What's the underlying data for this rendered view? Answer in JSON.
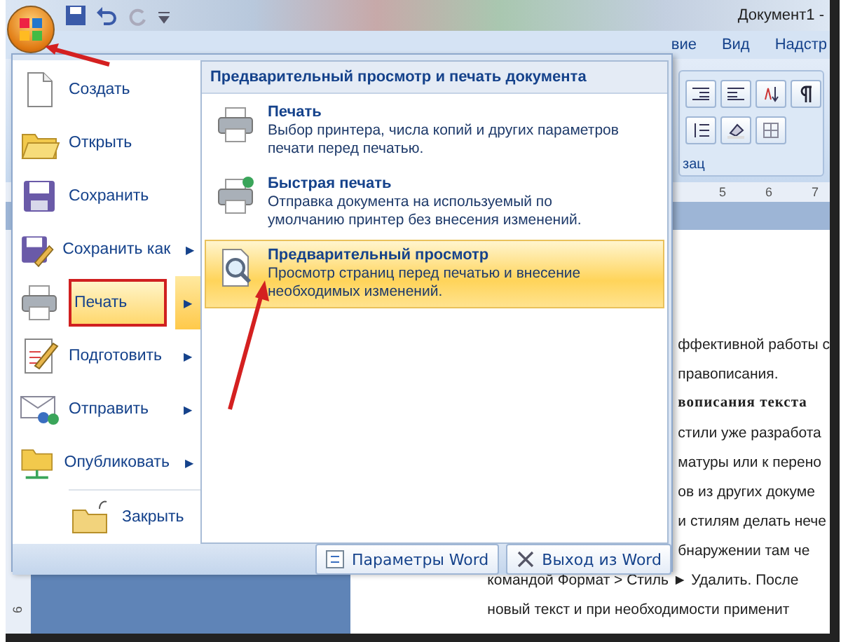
{
  "window": {
    "title": "Документ1 -"
  },
  "ribbon_tabs": [
    {
      "label": "вие"
    },
    {
      "label": "Вид"
    },
    {
      "label": "Надстр"
    }
  ],
  "ribbon": {
    "group_label": "зац",
    "ruler": [
      "5",
      "6",
      "7"
    ]
  },
  "office_menu": {
    "items": [
      {
        "label": "Создать",
        "kind": "new",
        "selected": false
      },
      {
        "label": "Открыть",
        "kind": "open",
        "selected": false
      },
      {
        "label": "Сохранить",
        "kind": "save",
        "selected": false
      },
      {
        "label": "Сохранить как",
        "kind": "saveas",
        "arrow": "▶",
        "selected": false
      },
      {
        "label": "Печать",
        "kind": "print",
        "arrow": "▶",
        "selected": true
      },
      {
        "label": "Подготовить",
        "kind": "prepare",
        "arrow": "▶",
        "selected": false
      },
      {
        "label": "Отправить",
        "kind": "send",
        "arrow": "▶",
        "selected": false
      },
      {
        "label": "Опубликовать",
        "kind": "publish",
        "arrow": "▶",
        "selected": false
      },
      {
        "label": "Закрыть",
        "kind": "close",
        "selected": false
      }
    ],
    "panel": {
      "title": "Предварительный просмотр и печать документа",
      "items": [
        {
          "title": "Печать",
          "description": "Выбор принтера, числа копий и других параметров печати перед печатью.",
          "kind": "print",
          "selected": false
        },
        {
          "title": "Быстрая печать",
          "description": "Отправка документа на используемый по умолчанию принтер без внесения изменений.",
          "kind": "quickprint",
          "selected": false
        },
        {
          "title": "Предварительный просмотр",
          "description": "Просмотр страниц перед печатью и внесение необходимых изменений.",
          "kind": "preview",
          "selected": true
        }
      ]
    },
    "buttons": [
      {
        "label": "Параметры Word",
        "kind": "options"
      },
      {
        "label": "Выход из Word",
        "kind": "exit"
      }
    ]
  },
  "document": {
    "lines": [
      {
        "text": "ффективной работы с",
        "kind": "covered"
      },
      {
        "text": "правописания.",
        "kind": "covered"
      },
      {
        "text": "вописания текста",
        "kind": "heading"
      },
      {
        "text": "стили уже разработа",
        "kind": "covered"
      },
      {
        "text": "матуры или к перено",
        "kind": "covered"
      },
      {
        "text": "ов из других докуме",
        "kind": "covered"
      },
      {
        "text": "и стилям делать нече",
        "kind": "covered"
      },
      {
        "text": "бнаружении там че",
        "kind": "covered"
      },
      {
        "text": "командой Формат > Стиль ► Удалить. После",
        "kind": "full"
      },
      {
        "text": "новый текст и при необходимости применит",
        "kind": "full"
      }
    ]
  },
  "vertical_ruler": "6"
}
